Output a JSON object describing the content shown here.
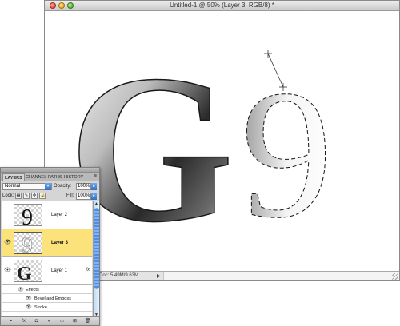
{
  "document": {
    "title": "Untitled-1 @ 50% (Layer 3, RGB/8) *",
    "status": "Doc: 5.49M/9.63M",
    "status_arrow": "▶"
  },
  "artwork": {
    "letter_g": "G",
    "superscript_9": "9"
  },
  "layers_panel": {
    "tabs": [
      {
        "label": "LAYERS",
        "active": true
      },
      {
        "label": "CHANNEL",
        "active": false
      },
      {
        "label": "PATHS",
        "active": false
      },
      {
        "label": "HISTORY",
        "active": false
      }
    ],
    "menu_icon": "≡",
    "blend_mode": "Normal",
    "opacity_label": "Opacity:",
    "opacity_value": "100%",
    "lock_label": "Lock:",
    "lock_icons": [
      "▦",
      "✎",
      "✥",
      "🔒"
    ],
    "fill_label": "Fill:",
    "fill_value": "100%",
    "layers": [
      {
        "name": "Layer 2",
        "visible": false,
        "selected": false,
        "thumb_glyph": "9"
      },
      {
        "name": "Layer 3",
        "visible": true,
        "selected": true,
        "thumb_glyph": "9"
      },
      {
        "name": "Layer 1",
        "visible": true,
        "selected": false,
        "thumb_glyph": "G",
        "fx": "fx"
      }
    ],
    "effects": {
      "header": "Effects",
      "items": [
        "Bevel and Emboss",
        "Stroke"
      ]
    },
    "bottom_icons": [
      "link-icon",
      "fx-icon",
      "mask-icon",
      "adjustment-icon",
      "folder-icon",
      "new-layer-icon",
      "trash-icon"
    ],
    "bottom_glyphs": [
      "⚭",
      "fx",
      "◘",
      "◐",
      "▭",
      "⊞",
      "🗑"
    ]
  },
  "colors": {
    "selected_layer": "#fbe27b",
    "scroll_accent": "#4e8fdf"
  }
}
